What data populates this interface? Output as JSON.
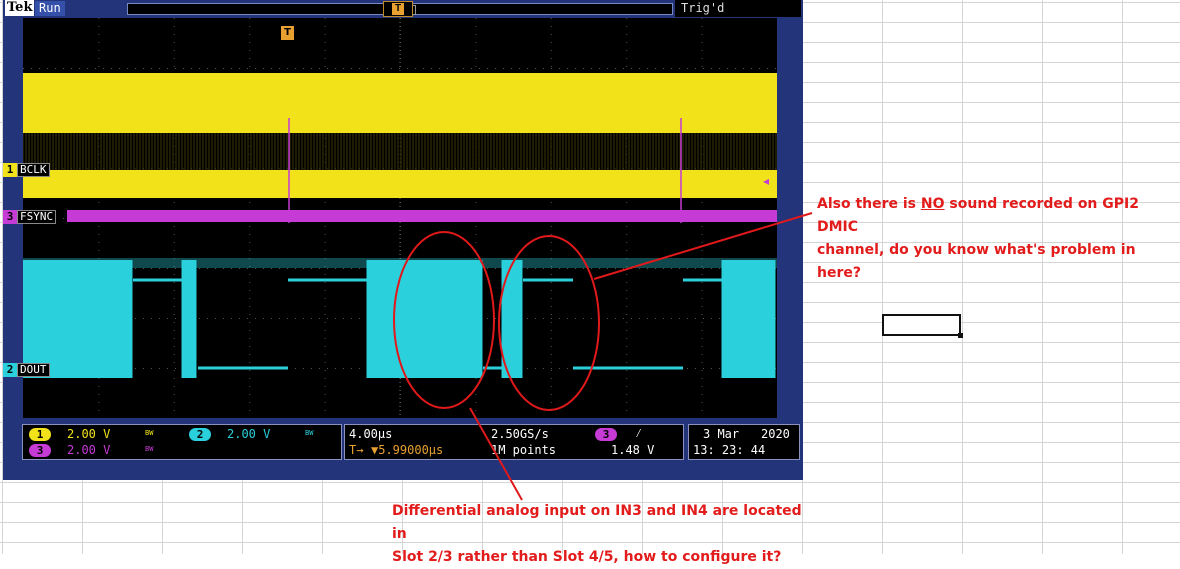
{
  "scope": {
    "brand": "Tek",
    "run_state": "Run",
    "trigger_state": "Trig'd",
    "trigger_marker": "T",
    "channels": [
      {
        "id": "1",
        "name": "BCLK",
        "color": "#f2e21a"
      },
      {
        "id": "3",
        "name": "FSYNC",
        "color": "#c63ad6"
      },
      {
        "id": "2",
        "name": "DOUT",
        "color": "#2ad0dc"
      }
    ],
    "vertical": {
      "ch1_scale": "2.00 V",
      "ch2_scale": "2.00 V",
      "ch3_scale": "2.00 V",
      "bw_mark": "BW"
    },
    "horizontal": {
      "timebase": "4.00µs",
      "position": "▼5.99000µs",
      "trigger_arrow": "T→",
      "sample_rate": "2.50GS/s",
      "record_length": "1M points"
    },
    "trigger": {
      "source": "3",
      "slope": "⁄",
      "level": "1.48 V"
    },
    "datetime": {
      "date": "3 Mar",
      "year": "2020",
      "time": "13: 23: 44"
    }
  },
  "annotations": {
    "right_note_line1_pre": "Also there is ",
    "right_note_line1_em": "NO",
    "right_note_line1_post": " sound recorded on GPI2 DMIC",
    "right_note_line2": "channel, do you know what's problem in here?",
    "bottom_note_line1": "Differential  analog input on IN3 and IN4 are located in",
    "bottom_note_line2": "Slot 2/3 rather than Slot 4/5, how to configure it?",
    "color": "#e21b1b"
  }
}
